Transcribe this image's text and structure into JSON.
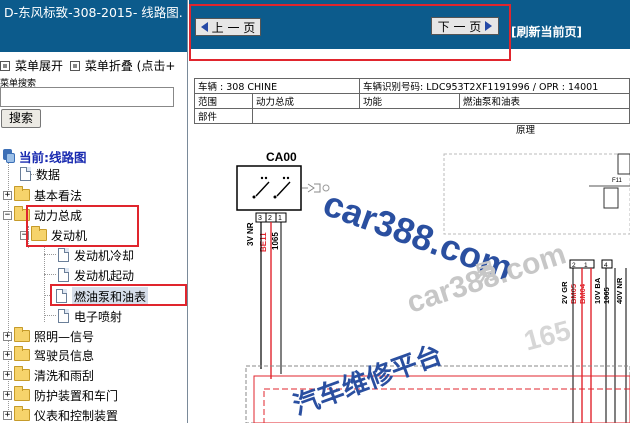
{
  "sidebar": {
    "title": "D-东风标致-308-2015- 线路图.",
    "menu_expand": "菜单展开",
    "menu_collapse": "菜单折叠 (点击+",
    "search_label": "菜单搜索",
    "search_value": "",
    "search_button": "搜索",
    "tree": {
      "root": "当前:线路图",
      "items": [
        {
          "label": "数据"
        },
        {
          "label": "基本看法"
        },
        {
          "label": "动力总成"
        },
        {
          "label": "发动机"
        },
        {
          "label": "发动机冷却"
        },
        {
          "label": "发动机起动"
        },
        {
          "label": "燃油泵和油表"
        },
        {
          "label": "电子喷射"
        },
        {
          "label": "照明—信号"
        },
        {
          "label": "驾驶员信息"
        },
        {
          "label": "清洗和雨刮"
        },
        {
          "label": "防护装置和车门"
        },
        {
          "label": "仪表和控制装置"
        }
      ]
    }
  },
  "content": {
    "prev_button": "上 一 页",
    "next_button": "下 一 页",
    "refresh": "[刷新当前页]",
    "info": {
      "vehicle": "车辆 : 308 CHINE",
      "vin": "车辆识别号码: LDC953T2XF1191996 / OPR : 14001",
      "scope_label": "范围",
      "scope_value": "动力总成",
      "function_label": "功能",
      "function_value": "燃油泵和油表",
      "part_label": "部件"
    },
    "diagram_title": "原理",
    "diagram": {
      "component": "CA00",
      "pins": [
        "3",
        "2",
        "1"
      ],
      "left_wires": [
        "3V NR",
        "BE11",
        "1065"
      ],
      "connector_label": "F11",
      "right_wires": [
        "2V GR",
        "BM05",
        "BM04",
        "10V BA",
        "1065",
        "40V NR"
      ],
      "right_pins": [
        "2",
        "1",
        "4"
      ]
    },
    "watermarks": [
      "car388.com",
      "car388.com",
      "汽车维修平台",
      "易",
      "165"
    ]
  },
  "colors": {
    "header_blue": "#0c5b8c",
    "highlight_red": "#e0252d",
    "tree_root_blue": "#1a2bb0",
    "diagram_red": "#e0252d",
    "watermark_blue": "#2a4fa0"
  }
}
